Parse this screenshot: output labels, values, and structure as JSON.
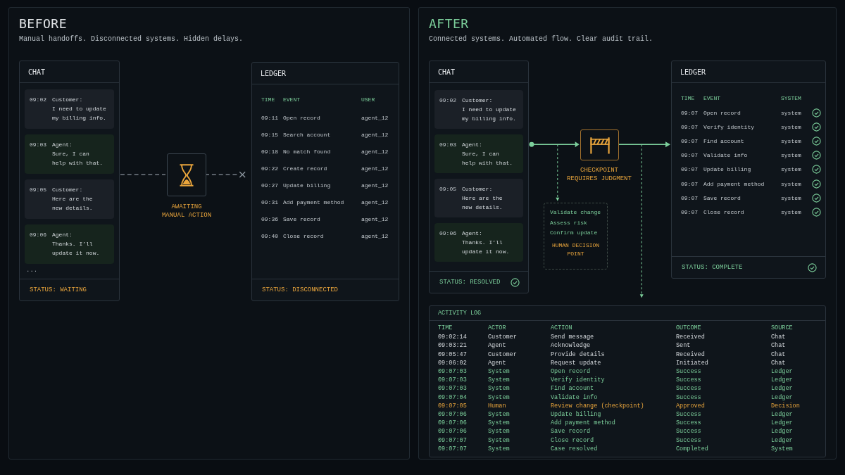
{
  "before": {
    "title": "BEFORE",
    "subtitle": "Manual handoffs. Disconnected systems. Hidden delays.",
    "chat": {
      "title": "CHAT",
      "messages": [
        {
          "time": "09:02",
          "sender": "Customer:",
          "lines": [
            "I need to update",
            "my billing info."
          ],
          "kind": "customer"
        },
        {
          "time": "09:03",
          "sender": "Agent:",
          "lines": [
            "Sure, I can",
            "help with that."
          ],
          "kind": "agent"
        },
        {
          "time": "09:05",
          "sender": "Customer:",
          "lines": [
            "Here are the",
            "new details."
          ],
          "kind": "customer"
        },
        {
          "time": "09:06",
          "sender": "Agent:",
          "lines": [
            "Thanks. I’ll",
            "update it now."
          ],
          "kind": "agent"
        }
      ],
      "more": "...",
      "status": {
        "text": "STATUS: WAITING",
        "kind": "warning"
      }
    },
    "handoff": {
      "label": [
        "AWAITING",
        "MANUAL ACTION"
      ]
    },
    "ledger": {
      "title": "LEDGER",
      "columns": [
        "TIME",
        "EVENT",
        "USER"
      ],
      "rows": [
        {
          "time": "09:11",
          "event": "Open record",
          "user": "agent_12"
        },
        {
          "time": "09:15",
          "event": "Search account",
          "user": "agent_12"
        },
        {
          "time": "09:18",
          "event": "No match found",
          "user": "agent_12"
        },
        {
          "time": "09:22",
          "event": "Create record",
          "user": "agent_12"
        },
        {
          "time": "09:27",
          "event": "Update billing",
          "user": "agent_12"
        },
        {
          "time": "09:31",
          "event": "Add payment method",
          "user": "agent_12"
        },
        {
          "time": "09:36",
          "event": "Save record",
          "user": "agent_12"
        },
        {
          "time": "09:40",
          "event": "Close record",
          "user": "agent_12"
        }
      ],
      "status": {
        "text": "STATUS: DISCONNECTED",
        "kind": "warning"
      }
    }
  },
  "after": {
    "title": "AFTER",
    "subtitle": "Connected systems. Automated flow. Clear audit trail.",
    "chat": {
      "title": "CHAT",
      "messages": [
        {
          "time": "09:02",
          "sender": "Customer:",
          "lines": [
            "I need to update",
            "my billing info."
          ],
          "kind": "customer"
        },
        {
          "time": "09:03",
          "sender": "Agent:",
          "lines": [
            "Sure, I can",
            "help with that."
          ],
          "kind": "agent"
        },
        {
          "time": "09:05",
          "sender": "Customer:",
          "lines": [
            "Here are the",
            "new details."
          ],
          "kind": "customer"
        },
        {
          "time": "09:06",
          "sender": "Agent:",
          "lines": [
            "Thanks. I’ll",
            "update it now."
          ],
          "kind": "agent"
        }
      ],
      "status": {
        "text": "STATUS: RESOLVED",
        "kind": "ok"
      }
    },
    "checkpoint": {
      "label": [
        "CHECKPOINT",
        "REQUIRES JUDGMENT"
      ]
    },
    "decision_box": {
      "steps": [
        "Validate change",
        "Assess risk",
        "Confirm update"
      ],
      "label": [
        "HUMAN DECISION",
        "POINT"
      ]
    },
    "ledger": {
      "title": "LEDGER",
      "columns": [
        "TIME",
        "EVENT",
        "SYSTEM"
      ],
      "rows": [
        {
          "time": "09:07",
          "event": "Open record",
          "user": "system",
          "done": true
        },
        {
          "time": "09:07",
          "event": "Verify identity",
          "user": "system",
          "done": true
        },
        {
          "time": "09:07",
          "event": "Find account",
          "user": "system",
          "done": true
        },
        {
          "time": "09:07",
          "event": "Validate info",
          "user": "system",
          "done": true
        },
        {
          "time": "09:07",
          "event": "Update billing",
          "user": "system",
          "done": true
        },
        {
          "time": "09:07",
          "event": "Add payment method",
          "user": "system",
          "done": true
        },
        {
          "time": "09:07",
          "event": "Save record",
          "user": "system",
          "done": true
        },
        {
          "time": "09:07",
          "event": "Close record",
          "user": "system",
          "done": true
        }
      ],
      "status": {
        "text": "STATUS: COMPLETE",
        "kind": "ok"
      }
    },
    "activity_log": {
      "title": "ACTIVITY LOG",
      "columns": [
        "TIME",
        "ACTOR",
        "ACTION",
        "OUTCOME",
        "SOURCE"
      ],
      "rows": [
        {
          "cells": [
            "09:02:14",
            "Customer",
            "Send message",
            "Received",
            "Chat"
          ],
          "kind": "chat"
        },
        {
          "cells": [
            "09:03:21",
            "Agent",
            "Acknowledge",
            "Sent",
            "Chat"
          ],
          "kind": "chat"
        },
        {
          "cells": [
            "09:05:47",
            "Customer",
            "Provide details",
            "Received",
            "Chat"
          ],
          "kind": "chat"
        },
        {
          "cells": [
            "09:06:02",
            "Agent",
            "Request update",
            "Initiated",
            "Chat"
          ],
          "kind": "chat"
        },
        {
          "cells": [
            "09:07:03",
            "System",
            "Open record",
            "Success",
            "Ledger"
          ],
          "kind": "system"
        },
        {
          "cells": [
            "09:07:03",
            "System",
            "Verify identity",
            "Success",
            "Ledger"
          ],
          "kind": "system"
        },
        {
          "cells": [
            "09:07:03",
            "System",
            "Find account",
            "Success",
            "Ledger"
          ],
          "kind": "system"
        },
        {
          "cells": [
            "09:07:04",
            "System",
            "Validate info",
            "Success",
            "Ledger"
          ],
          "kind": "system"
        },
        {
          "cells": [
            "09:07:05",
            "Human",
            "Review change (checkpoint)",
            "Approved",
            "Decision"
          ],
          "kind": "decision"
        },
        {
          "cells": [
            "09:07:06",
            "System",
            "Update billing",
            "Success",
            "Ledger"
          ],
          "kind": "system"
        },
        {
          "cells": [
            "09:07:06",
            "System",
            "Add payment method",
            "Success",
            "Ledger"
          ],
          "kind": "system"
        },
        {
          "cells": [
            "09:07:06",
            "System",
            "Save record",
            "Success",
            "Ledger"
          ],
          "kind": "system"
        },
        {
          "cells": [
            "09:07:07",
            "System",
            "Close record",
            "Success",
            "Ledger"
          ],
          "kind": "system"
        },
        {
          "cells": [
            "09:07:07",
            "System",
            "Case resolved",
            "Completed",
            "System"
          ],
          "kind": "system"
        }
      ]
    }
  }
}
